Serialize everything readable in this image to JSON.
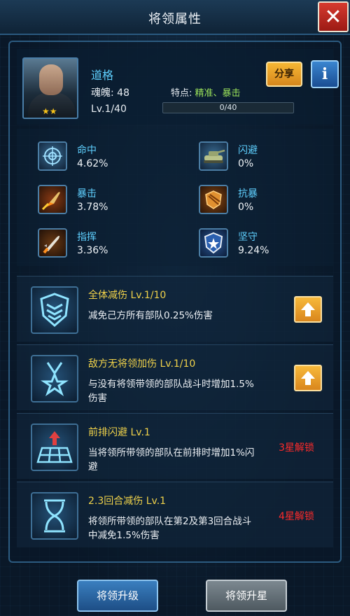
{
  "header": {
    "title": "将领属性",
    "close_label": "✕"
  },
  "hero": {
    "name": "道格",
    "soul_label": "魂魄: 48",
    "trait_label": "特点: ",
    "trait_value": "精准、暴击",
    "level": "Lv.1/40",
    "exp_text": "0/40",
    "exp_progress": 0,
    "stars": "★★",
    "share_label": "分享",
    "info_label": "i"
  },
  "stats": [
    {
      "label": "命中",
      "value": "4.62%",
      "icon": "crosshair-icon"
    },
    {
      "label": "闪避",
      "value": "0%",
      "icon": "tank-icon"
    },
    {
      "label": "暴击",
      "value": "3.78%",
      "icon": "flaming-bullet-icon"
    },
    {
      "label": "抗暴",
      "value": "0%",
      "icon": "armor-plate-icon"
    },
    {
      "label": "指挥",
      "value": "3.36%",
      "icon": "missile-icon"
    },
    {
      "label": "坚守",
      "value": "9.24%",
      "icon": "star-shield-icon"
    }
  ],
  "skills": [
    {
      "title": "全体减伤 Lv.1/10",
      "desc": "减免己方所有部队0.25%伤害",
      "action": "upgrade",
      "icon": "shield-icon"
    },
    {
      "title": "敌方无将领加伤 Lv.1/10",
      "desc": "与没有将领带领的部队战斗时增加1.5%伤害",
      "action": "upgrade",
      "icon": "medal-icon"
    },
    {
      "title": "前排闪避 Lv.1",
      "desc": "当将领所带领的部队在前排时增加1%闪避",
      "action": "3星解锁",
      "icon": "front-row-icon"
    },
    {
      "title": "2.3回合减伤 Lv.1",
      "desc": "将领所带领的部队在第2及第3回合战斗中减免1.5%伤害",
      "action": "4星解锁",
      "icon": "hourglass-icon"
    }
  ],
  "buttons": {
    "upgrade_hero": "将领升级",
    "star_up": "将领升星"
  },
  "colors": {
    "accent_blue": "#5fd0ff",
    "skill_title": "#f0d24a",
    "locked_red": "#ff2a2a",
    "trait_green": "#9be35a"
  }
}
